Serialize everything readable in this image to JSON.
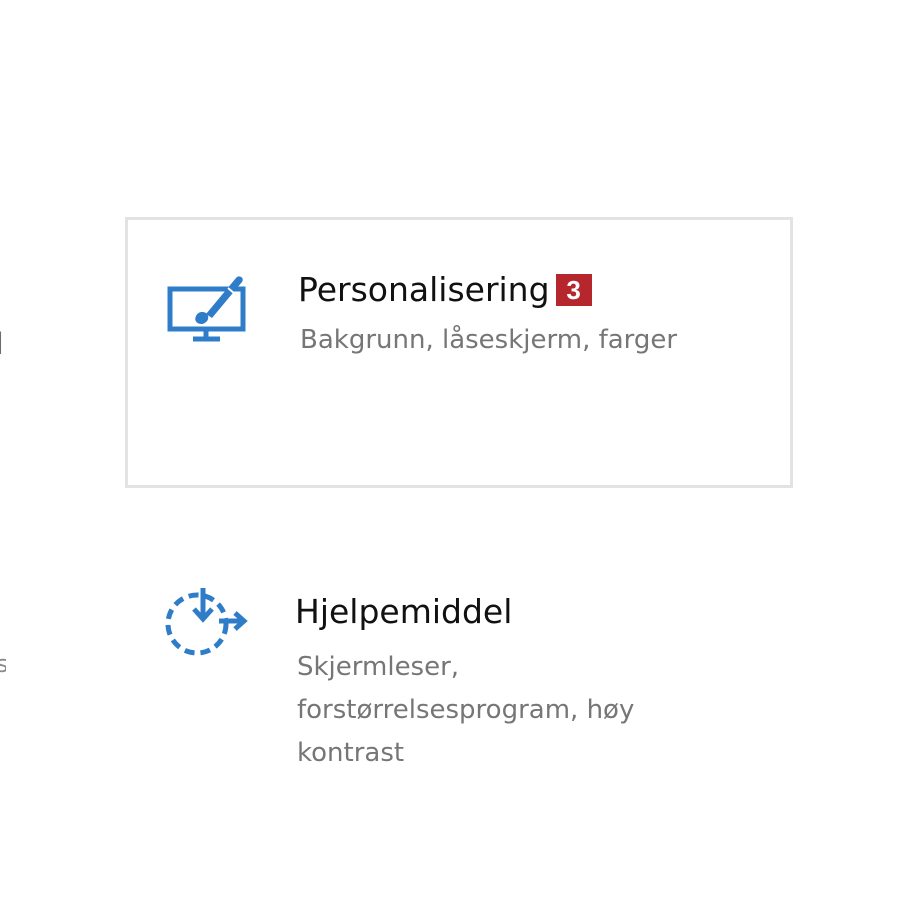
{
  "colors": {
    "accent": "#2f7dc8",
    "badge": "#b5262d",
    "tile_border": "#e3e3e3"
  },
  "edge_fragments": [
    "|",
    "s"
  ],
  "tiles": [
    {
      "title": "Personalisering",
      "description": "Bakgrunn, låseskjerm, farger",
      "icon": "personalization-icon",
      "badge": "3",
      "selected": true
    },
    {
      "title": "Hjelpemiddel",
      "description": "Skjermleser, forstørrelsesprogram, høy kontrast",
      "icon": "ease-of-access-icon"
    }
  ]
}
